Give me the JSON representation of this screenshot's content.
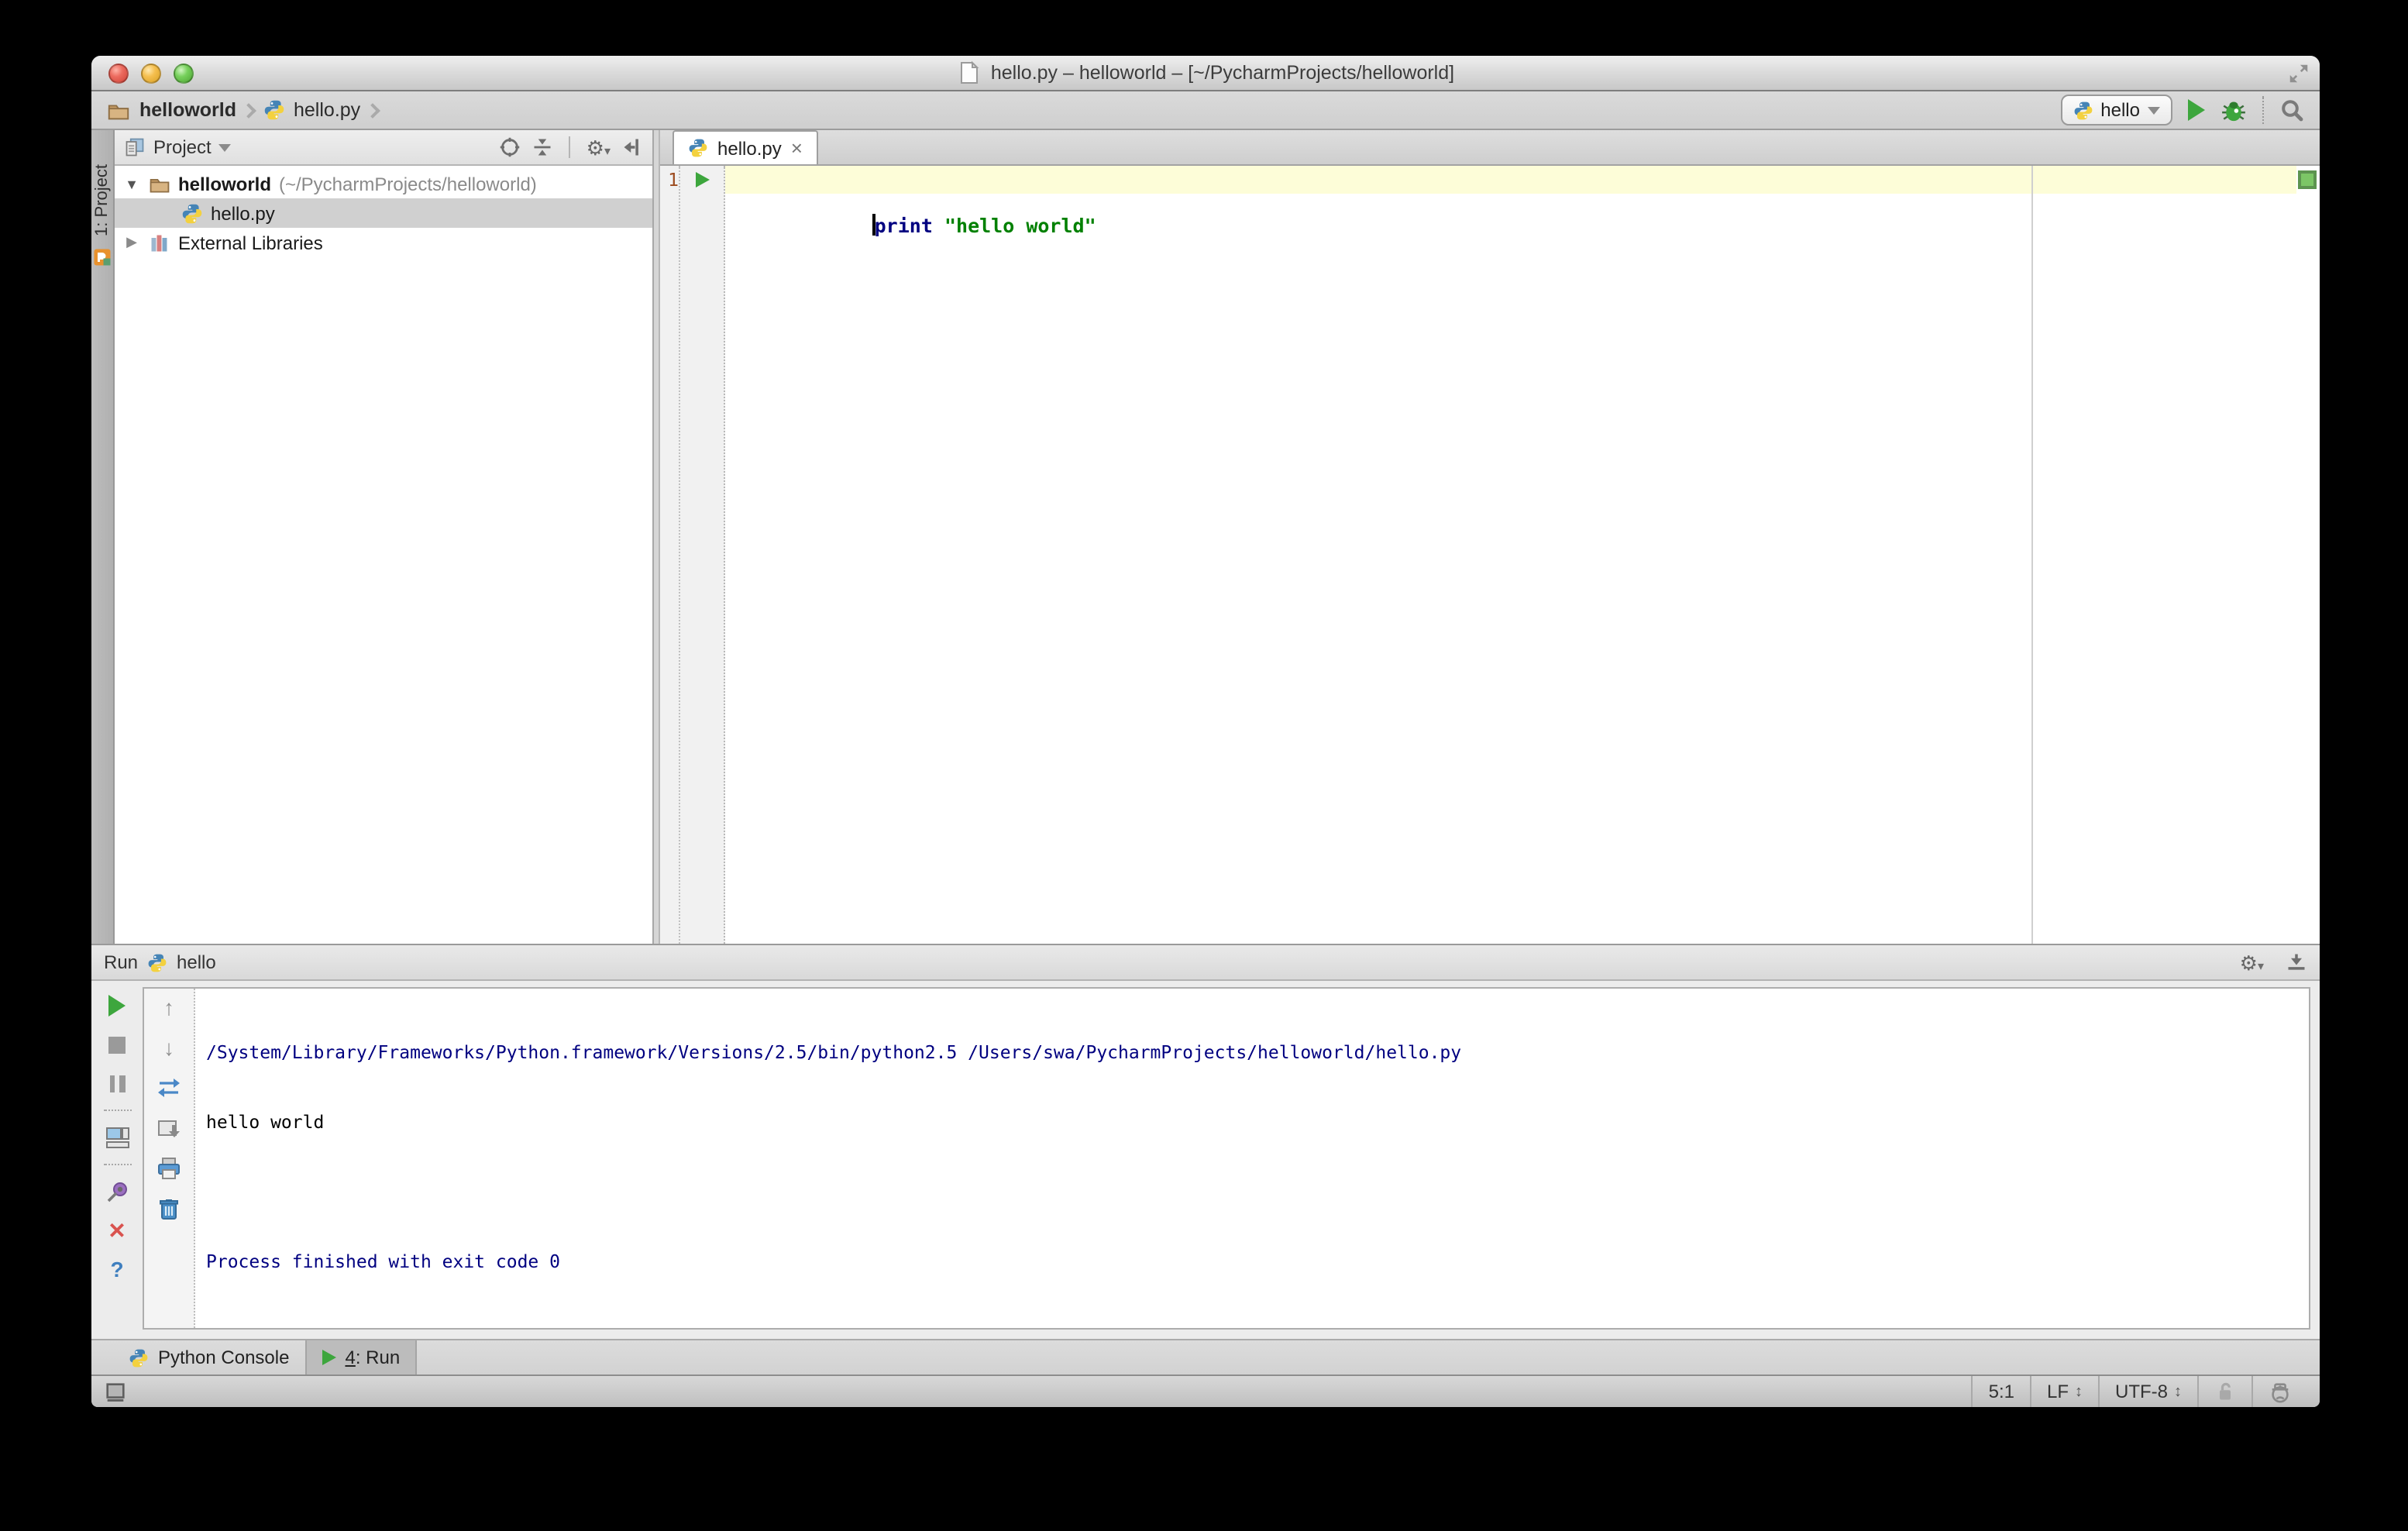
{
  "window": {
    "title": "hello.py – helloworld – [~/PycharmProjects/helloworld]"
  },
  "navbar": {
    "breadcrumb_project": "helloworld",
    "breadcrumb_file": "hello.py",
    "run_config": "hello"
  },
  "project_panel": {
    "stripe_label": "1: Project",
    "header_label": "Project",
    "tree": [
      {
        "name": "helloworld",
        "path": "(~/PycharmProjects/helloworld)",
        "expanded": true
      },
      {
        "name": "hello.py",
        "selected": true
      },
      {
        "name": "External Libraries",
        "expanded": false
      }
    ]
  },
  "editor": {
    "tab_label": "hello.py",
    "close_glyph": "×",
    "line_number": "1",
    "code": {
      "keyword": "print",
      "string": "\"hello world\""
    }
  },
  "run_panel": {
    "title": "Run",
    "config_name": "hello",
    "console": [
      {
        "text": "/System/Library/Frameworks/Python.framework/Versions/2.5/bin/python2.5 /Users/swa/PycharmProjects/helloworld/hello.py",
        "color": "#000080"
      },
      {
        "text": "hello world",
        "color": "#000000"
      },
      {
        "text": "",
        "color": "#000000"
      },
      {
        "text": "Process finished with exit code 0",
        "color": "#000080"
      }
    ]
  },
  "toolwindow_bar": {
    "python_console_label": "Python Console",
    "run_tab_number": "4",
    "run_tab_suffix": ": Run"
  },
  "status_bar": {
    "caret_position": "5:1",
    "line_separator": "LF",
    "encoding": "UTF-8"
  },
  "colors": {
    "keyword_blue": "#000080",
    "string_green": "#008000",
    "run_green": "#3da63d",
    "current_line": "#fdfdd8",
    "inspection_ok_green": "#7cc666"
  }
}
